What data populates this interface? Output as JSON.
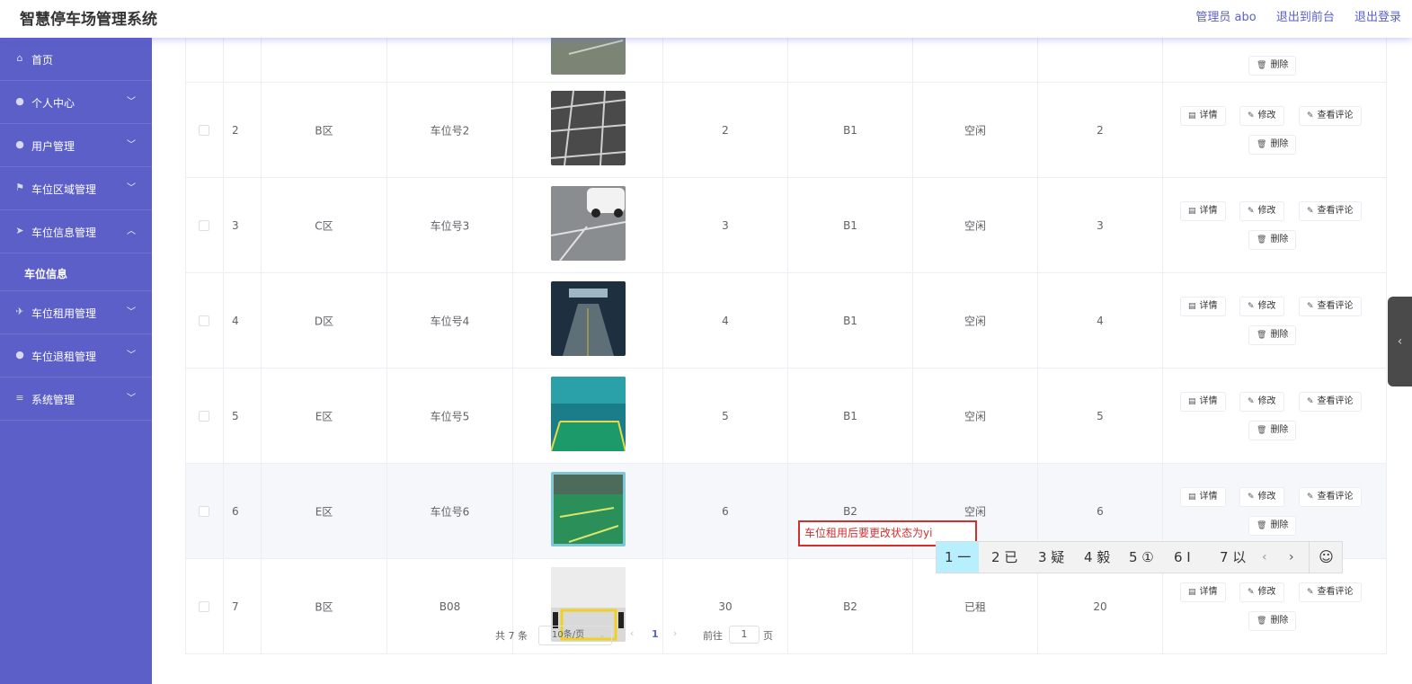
{
  "header": {
    "title": "智慧停车场管理系统",
    "admin": "管理员 abo",
    "frontend": "退出到前台",
    "logout": "退出登录"
  },
  "sidebar": {
    "items": [
      {
        "label": "首页",
        "icon": "home-icon"
      },
      {
        "label": "个人中心",
        "icon": "user-icon"
      },
      {
        "label": "用户管理",
        "icon": "user-icon"
      },
      {
        "label": "车位区域管理",
        "icon": "flag-icon"
      },
      {
        "label": "车位信息管理",
        "icon": "send-icon"
      },
      {
        "label": "车位信息",
        "icon": ""
      },
      {
        "label": "车位租用管理",
        "icon": "plane-icon"
      },
      {
        "label": "车位退租管理",
        "icon": "location-icon"
      },
      {
        "label": "系统管理",
        "icon": "menu-icon"
      }
    ]
  },
  "table": {
    "rows": [
      {
        "idx": "2",
        "area": "B区",
        "no": "车位号2",
        "a": "2",
        "b": "B1",
        "c": "空闲",
        "d": "2"
      },
      {
        "idx": "3",
        "area": "C区",
        "no": "车位号3",
        "a": "3",
        "b": "B1",
        "c": "空闲",
        "d": "3"
      },
      {
        "idx": "4",
        "area": "D区",
        "no": "车位号4",
        "a": "4",
        "b": "B1",
        "c": "空闲",
        "d": "4"
      },
      {
        "idx": "5",
        "area": "E区",
        "no": "车位号5",
        "a": "5",
        "b": "B1",
        "c": "空闲",
        "d": "5"
      },
      {
        "idx": "6",
        "area": "E区",
        "no": "车位号6",
        "a": "6",
        "b": "B2",
        "c": "空闲",
        "d": "6"
      },
      {
        "idx": "7",
        "area": "B区",
        "no": "B08",
        "a": "30",
        "b": "B2",
        "c": "已租",
        "d": "20"
      }
    ],
    "ops": {
      "detail": "详情",
      "edit": "修改",
      "review": "查看评论",
      "delete": "删除"
    }
  },
  "pagination": {
    "total": "共 7 条",
    "page_size": "10条/页",
    "current": "1",
    "goto": "前往",
    "goto_value": "1",
    "page_suffix": "页"
  },
  "ime": {
    "input_text": "车位租用后要更改状态为yi",
    "candidates": [
      "1 一",
      "2 已",
      "3 疑",
      "4 毅",
      "5 ①",
      "6 Ⅰ",
      "7 以"
    ]
  }
}
